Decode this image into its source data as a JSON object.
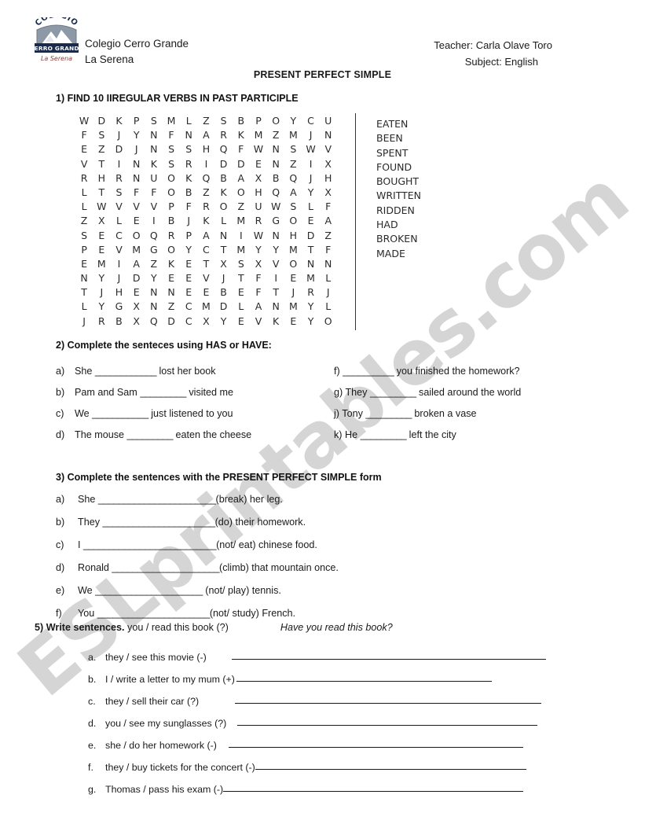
{
  "header": {
    "logo": {
      "top_text": "COLEGIO",
      "banner_text": "CERRO GRANDE",
      "sub_text": "La Serena"
    },
    "school_name": "Colegio Cerro Grande",
    "school_city": "La Serena",
    "teacher_line": "Teacher: Carla Olave Toro",
    "subject_line": "Subject: English",
    "document_title": "PRESENT PERFECT SIMPLE"
  },
  "watermark": {
    "text": "ESLprintables.com",
    "color": "#d5d5d5"
  },
  "exercise1": {
    "heading": "1)   FIND 10 IIREGULAR VERBS IN PAST PARTICIPLE",
    "grid_rows": [
      [
        "W",
        "D",
        "K",
        "P",
        "S",
        "M",
        "L",
        "Z",
        "S",
        "B",
        "P",
        "O",
        "Y",
        "C",
        "U",
        ""
      ],
      [
        "F",
        "S",
        "J",
        "Y",
        "N",
        "F",
        "N",
        "A",
        "R",
        "K",
        "M",
        "Z",
        "M",
        "J",
        "N",
        ""
      ],
      [
        "E",
        "Z",
        "D",
        "J",
        "N",
        "S",
        "S",
        "H",
        "Q",
        "F",
        "W",
        "N",
        "S",
        "W",
        "V",
        ""
      ],
      [
        "V",
        "T",
        "I",
        "N",
        "K",
        "S",
        "R",
        "I",
        "D",
        "D",
        "E",
        "N",
        "Z",
        "I",
        "X",
        ""
      ],
      [
        "R",
        "H",
        "R",
        "N",
        "U",
        "O",
        "K",
        "Q",
        "B",
        "A",
        "X",
        "B",
        "Q",
        "J",
        "H",
        ""
      ],
      [
        "L",
        "T",
        "S",
        "F",
        "F",
        "O",
        "B",
        "Z",
        "K",
        "O",
        "H",
        "Q",
        "A",
        "Y",
        "X",
        ""
      ],
      [
        "L",
        "W",
        "V",
        "V",
        "V",
        "P",
        "F",
        "R",
        "O",
        "Z",
        "U",
        "W",
        "S",
        "L",
        "F",
        ""
      ],
      [
        "Z",
        "X",
        "L",
        "E",
        "I",
        "B",
        "J",
        "K",
        "L",
        "M",
        "R",
        "G",
        "O",
        "E",
        "A",
        ""
      ],
      [
        "S",
        "E",
        "C",
        "O",
        "Q",
        "R",
        "P",
        "A",
        "N",
        "I",
        "W",
        "N",
        "H",
        "D",
        "Z",
        ""
      ],
      [
        "P",
        "E",
        "V",
        "M",
        "G",
        "O",
        "Y",
        "C",
        "T",
        "M",
        "Y",
        "Y",
        "M",
        "T",
        "F",
        ""
      ],
      [
        "E",
        "M",
        "I",
        "A",
        "Z",
        "K",
        "E",
        "T",
        "X",
        "S",
        "X",
        "V",
        "O",
        "N",
        "N",
        ""
      ],
      [
        "N",
        "Y",
        "J",
        "D",
        "Y",
        "E",
        "E",
        "V",
        "J",
        "T",
        "F",
        "I",
        "E",
        "M",
        "L",
        ""
      ],
      [
        "T",
        "J",
        "H",
        "E",
        "N",
        "N",
        "E",
        "E",
        "B",
        "E",
        "F",
        "T",
        "J",
        "R",
        "J",
        ""
      ],
      [
        "L",
        "Y",
        "G",
        "X",
        "N",
        "Z",
        "C",
        "M",
        "D",
        "L",
        "A",
        "N",
        "M",
        "Y",
        "L",
        ""
      ],
      [
        "J",
        "R",
        "B",
        "X",
        "Q",
        "D",
        "C",
        "X",
        "Y",
        "E",
        "V",
        "K",
        "E",
        "Y",
        "O",
        ""
      ]
    ],
    "word_list": [
      "EATEN",
      "BEEN",
      "SPENT",
      "FOUND",
      "BOUGHT",
      "WRITTEN",
      "RIDDEN",
      "HAD",
      "BROKEN",
      "MADE"
    ]
  },
  "exercise2": {
    "heading": "2)   Complete the senteces using HAS or HAVE:",
    "left_items": [
      {
        "label": "a)",
        "before": "She ",
        "blank": "____________",
        "after": " lost her book"
      },
      {
        "label": "b)",
        "before": "Pam and Sam ",
        "blank": "_________",
        "after": " visited me"
      },
      {
        "label": "c)",
        "before": "We ",
        "blank": "___________",
        "after": " just listened to you"
      },
      {
        "label": "d)",
        "before": "The mouse ",
        "blank": "_________",
        "after": " eaten the cheese"
      }
    ],
    "right_items": [
      {
        "label": "f)",
        "before": " ",
        "blank": "__________",
        "after": " you finished the homework?"
      },
      {
        "label": "g)",
        "before": " They ",
        "blank": "_________",
        "after": " sailed around the world"
      },
      {
        "label": "j)",
        "before": " Tony ",
        "blank": "_________",
        "after": " broken a vase"
      },
      {
        "label": "k)",
        "before": " He ",
        "blank": "_________",
        "after": " left the city"
      }
    ]
  },
  "exercise3": {
    "heading": "3)   Complete the sentences with the PRESENT PERFECT SIMPLE form",
    "items": [
      {
        "label": "a)",
        "before": "She ",
        "blank": "_______________________",
        "after": "(break) her leg."
      },
      {
        "label": "b)",
        "before": "They ",
        "blank": "______________________",
        "after": "(do) their homework."
      },
      {
        "label": "c)",
        "before": "I ",
        "blank": "__________________________",
        "after": "(not/ eat) chinese food."
      },
      {
        "label": "d)",
        "before": "Ronald ",
        "blank": "_____________________",
        "after": "(climb) that mountain once."
      },
      {
        "label": "e)",
        "before": "We ",
        "blank": "_____________________",
        "after": " (not/ play) tennis."
      },
      {
        "label": "f)",
        "before": "You ",
        "blank": "______________________",
        "after": "(not/ study) French."
      }
    ]
  },
  "exercise5": {
    "heading_bold": "5) Write sentences.",
    "heading_prompt": " you / read this book (?)",
    "heading_example": "Have you read this book?",
    "items": [
      {
        "label": "a.",
        "text": "they / see this movie (-)",
        "gap": 32,
        "rule_width": 400
      },
      {
        "label": "b.",
        "text": "I / write a letter to my mum (+)",
        "gap": 2,
        "rule_width": 325
      },
      {
        "label": "c.",
        "text": "they / sell their car (?)",
        "gap": 46,
        "rule_width": 390
      },
      {
        "label": "d.",
        "text": "you / see my sunglasses (?)",
        "gap": 14,
        "rule_width": 382
      },
      {
        "label": "e.",
        "text": "she / do her homework (-)",
        "gap": 15,
        "rule_width": 375
      },
      {
        "label": "f.",
        "text": "they / buy tickets for the concert (-)",
        "gap": 0,
        "rule_width": 345
      },
      {
        "label": "g.",
        "text": "Thomas / pass his exam (-)",
        "gap": 0,
        "rule_width": 382
      }
    ]
  }
}
